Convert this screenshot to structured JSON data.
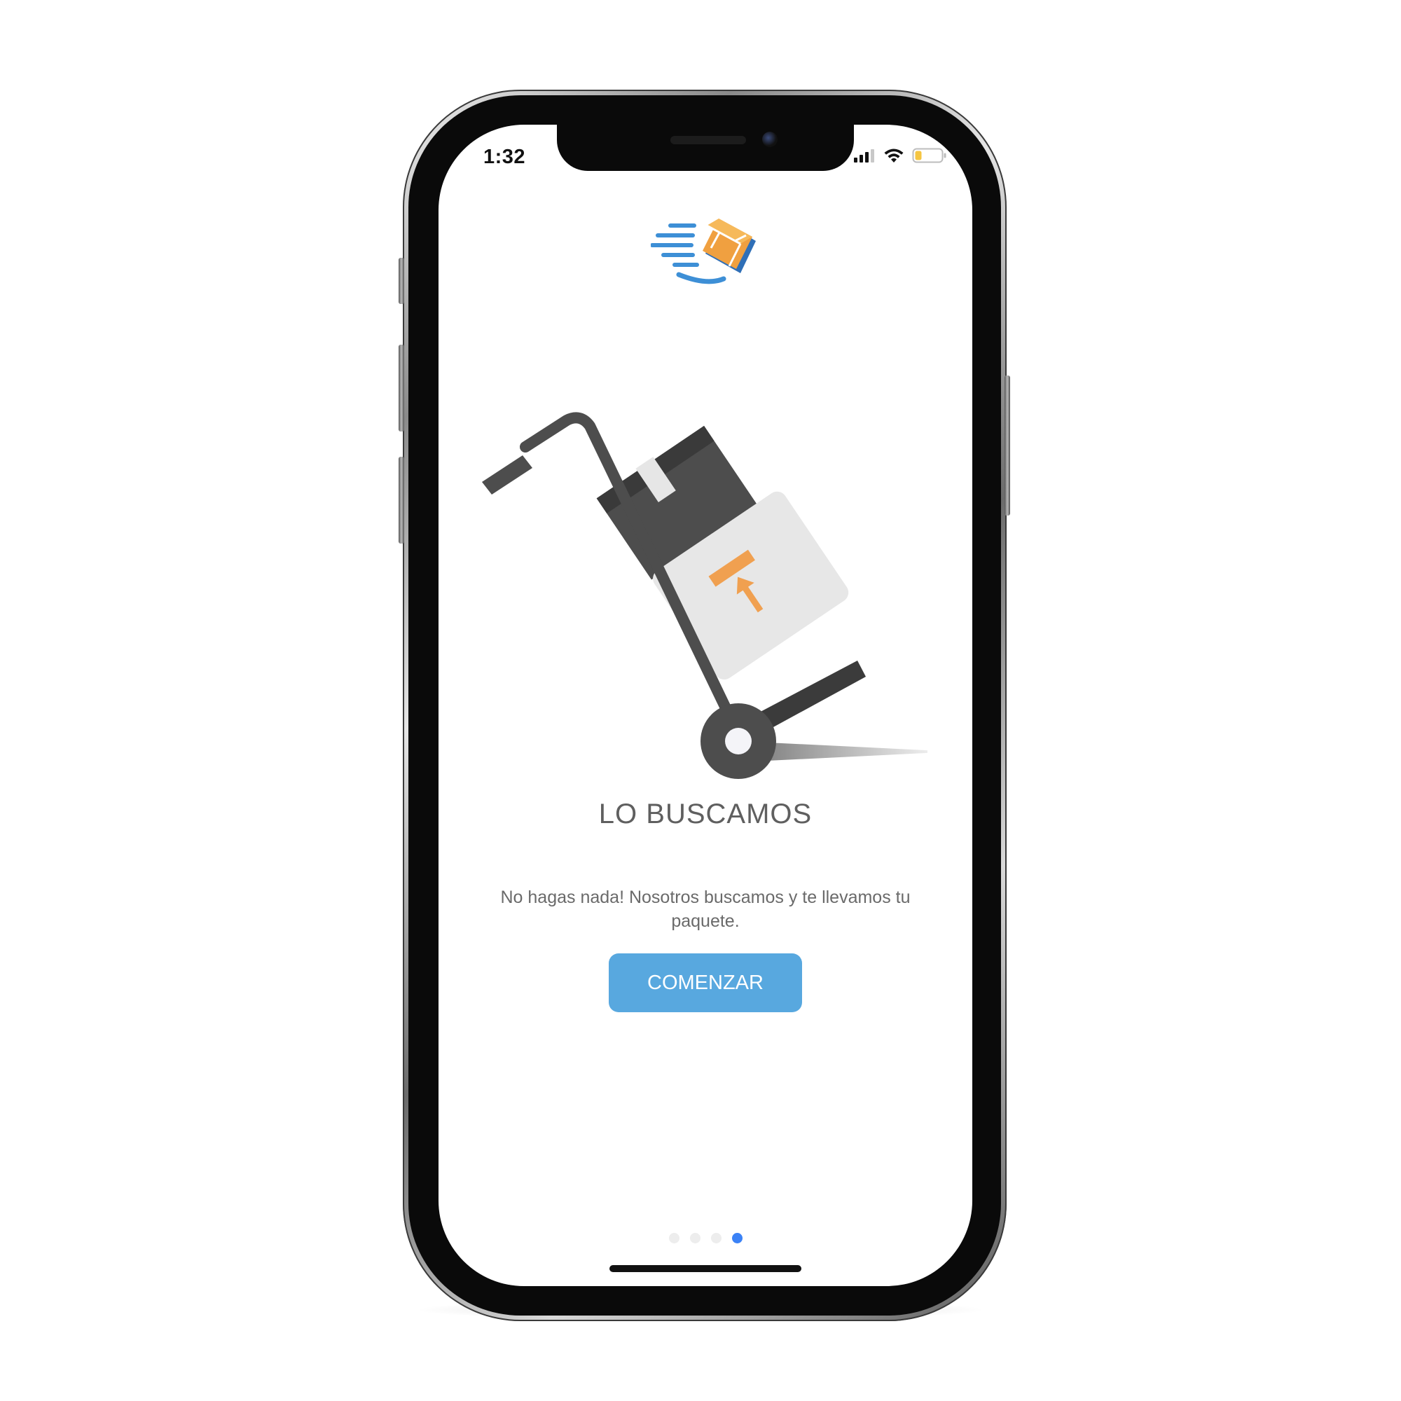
{
  "status_bar": {
    "time": "1:32",
    "icons": [
      "cellular-signal-icon",
      "wifi-icon",
      "battery-icon"
    ],
    "battery_level": 0.25,
    "battery_color": "#f5c542"
  },
  "onboarding": {
    "logo_icon": "flying-box-logo",
    "illustration_icon": "hand-truck-with-boxes",
    "title": "LO BUSCAMOS",
    "description": "No hagas nada! Nosotros buscamos y te llevamos tu paquete.",
    "start_label": "COMENZAR",
    "page_count": 4,
    "current_page": 4
  },
  "colors": {
    "accent": "#58a8df",
    "active_dot": "#3b82f6",
    "box_orange": "#f0a040",
    "dark_gray": "#4a4a4a"
  }
}
